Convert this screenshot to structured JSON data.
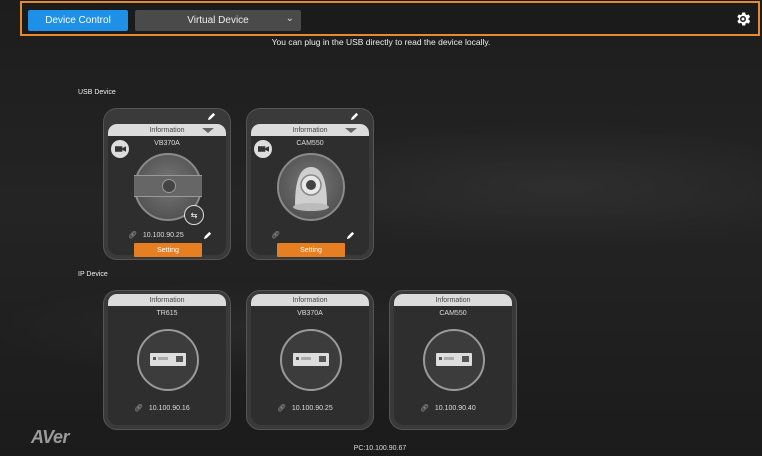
{
  "toolbar": {
    "device_control_label": "Device Control",
    "virtual_device_label": "Virtual Device",
    "accent_color": "#1e90e8",
    "highlight_color": "#e68a2e"
  },
  "hint_text": "You can plug in the USB directly to read the device locally.",
  "usb_section": {
    "label": "USB Device",
    "devices": [
      {
        "tab": "Information",
        "name": "VB370A",
        "ip": "10.100.90.25",
        "setting_label": "Setting"
      },
      {
        "tab": "Information",
        "name": "CAM550",
        "ip": "",
        "setting_label": "Setting"
      }
    ]
  },
  "ip_section": {
    "label": "IP Device",
    "devices": [
      {
        "tab": "Information",
        "name": "TR615",
        "ip": "10.100.90.16"
      },
      {
        "tab": "Information",
        "name": "VB370A",
        "ip": "10.100.90.25"
      },
      {
        "tab": "Information",
        "name": "CAM550",
        "ip": "10.100.90.40"
      }
    ]
  },
  "footer": {
    "logo": "AVer",
    "pc_ip": "PC:10.100.90.67"
  },
  "icons": [
    "settings-gear-icon",
    "chevron-down-icon",
    "pencil-icon",
    "camera-icon",
    "link-icon",
    "swap-icon",
    "device-box-icon"
  ],
  "button_color_setting": "#e67e22"
}
